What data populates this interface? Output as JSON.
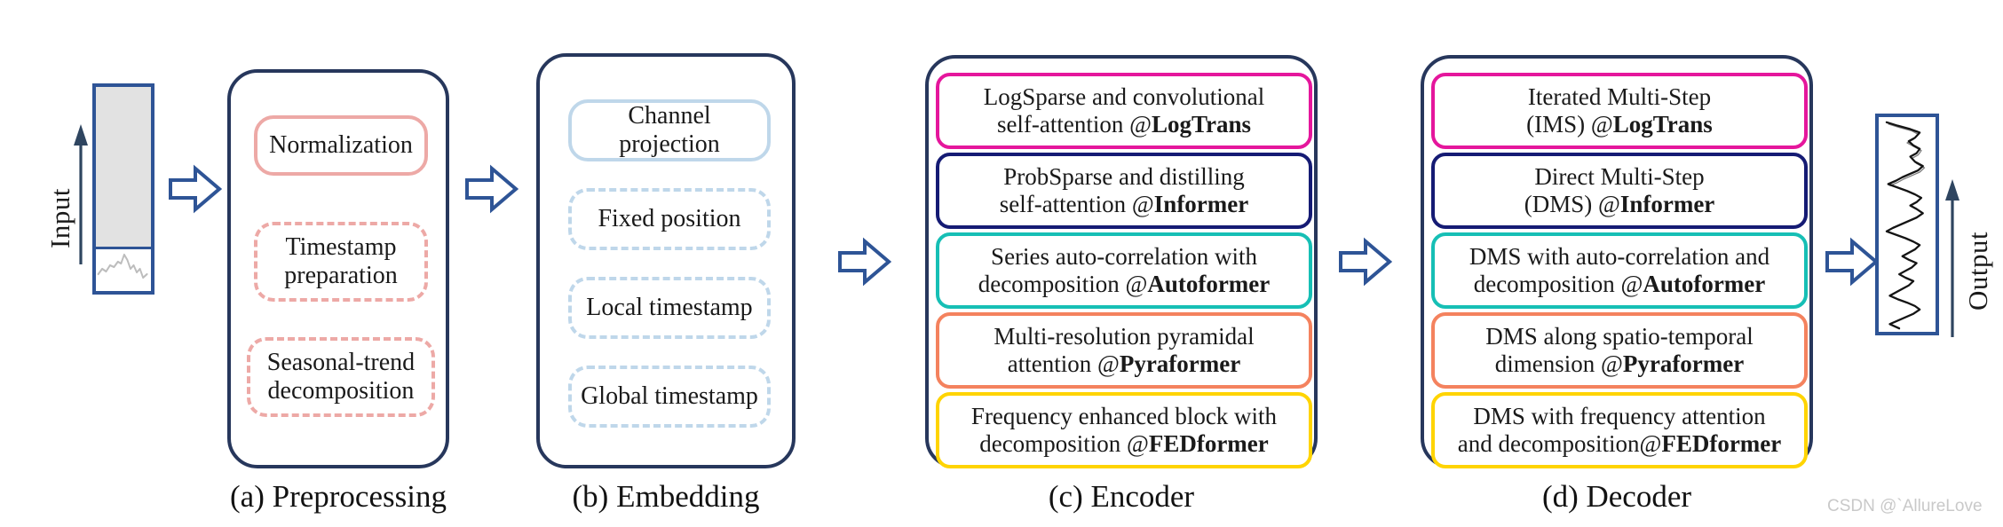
{
  "figure": {
    "watermark": "CSDN @`AllureLove"
  },
  "input": {
    "label": "Input",
    "block_fill_color": "#e2e2e2",
    "block_border_color": "#2e5496"
  },
  "output": {
    "label": "Output",
    "block_border_color": "#2e5496"
  },
  "arrows": {
    "count": 5,
    "glyph": "block-arrow-right",
    "color": "#2e5496"
  },
  "stages": [
    {
      "id": "preprocessing",
      "caption": "(a) Preprocessing",
      "accent": "#eda9a6",
      "items": [
        {
          "label": "Normalization",
          "style": "solid"
        },
        {
          "label": "Timestamp\npreparation",
          "line1": "Timestamp",
          "line2": "preparation",
          "style": "dashed"
        },
        {
          "label": "Seasonal-trend\ndecomposition",
          "line1": "Seasonal-trend",
          "line2": "decomposition",
          "style": "dashed"
        }
      ]
    },
    {
      "id": "embedding",
      "caption": "(b) Embedding",
      "accent": "#bfd7ea",
      "items": [
        {
          "label": "Channel projection",
          "style": "solid"
        },
        {
          "label": "Fixed position",
          "style": "dashed"
        },
        {
          "label": "Local timestamp",
          "style": "dashed"
        },
        {
          "label": "Global timestamp",
          "style": "dashed"
        }
      ]
    },
    {
      "id": "encoder",
      "caption": "(c) Encoder",
      "accent": "#27375c",
      "items": [
        {
          "line1": "LogSparse and convolutional",
          "line2_pre": "self-attention @",
          "model": "LogTrans",
          "color": "#e5169c"
        },
        {
          "line1": "ProbSparse and distilling",
          "line2_pre": "self-attention @",
          "model": "Informer",
          "color": "#151b74"
        },
        {
          "line1": "Series auto-correlation with",
          "line2_pre": "decomposition @",
          "model": "Autoformer",
          "color": "#16bfb5"
        },
        {
          "line1": "Multi-resolution pyramidal",
          "line2_pre": "attention @",
          "model": "Pyraformer",
          "color": "#f4825e"
        },
        {
          "line1": "Frequency enhanced block with",
          "line2_pre": "decomposition @",
          "model": "FEDformer",
          "color": "#ffd400"
        }
      ]
    },
    {
      "id": "decoder",
      "caption": "(d) Decoder",
      "accent": "#27375c",
      "items": [
        {
          "line1": "Iterated Multi-Step",
          "line2_pre": "(IMS) @",
          "model": "LogTrans",
          "color": "#e5169c"
        },
        {
          "line1": "Direct Multi-Step",
          "line2_pre": "(DMS) @",
          "model": "Informer",
          "color": "#151b74"
        },
        {
          "line1": "DMS with auto-correlation and",
          "line2_pre": "decomposition @",
          "model": "Autoformer",
          "color": "#16bfb5"
        },
        {
          "line1": "DMS along spatio-temporal",
          "line2_pre": "dimension @",
          "model": "Pyraformer",
          "color": "#f4825e"
        },
        {
          "line1": "DMS with frequency attention",
          "line2_pre": "and decomposition@",
          "model": "FEDformer",
          "color": "#ffd400"
        }
      ]
    }
  ]
}
